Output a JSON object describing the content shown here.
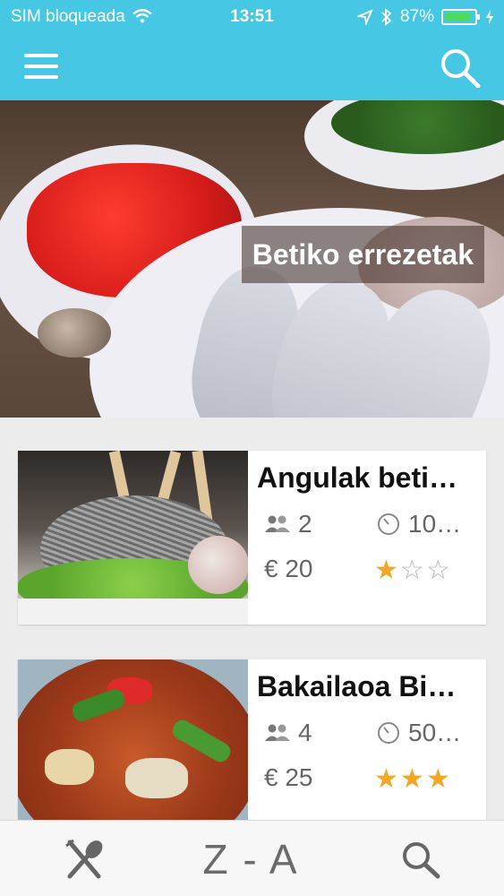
{
  "status_bar": {
    "carrier": "SIM bloqueada",
    "time": "13:51",
    "battery": "87%",
    "battery_level": 0.87
  },
  "header": {
    "menu_icon": "hamburger-icon",
    "search_icon": "search-icon",
    "background_color": "#46c7e3"
  },
  "hero": {
    "title": "Betiko errezetak"
  },
  "recipes": [
    {
      "title": "Angulak beti…",
      "people": "2",
      "time": "10…",
      "price": "€ 20",
      "rating": 1,
      "rating_max": 3
    },
    {
      "title": "Bakailaoa Bi…",
      "people": "4",
      "time": "50…",
      "price": "€ 25",
      "rating": 3,
      "rating_max": 3
    }
  ],
  "tabbar": {
    "sort_label": "Z - A",
    "recipes_icon": "spoon-knife-icon",
    "search_icon": "search-icon"
  },
  "colors": {
    "accent": "#46c7e3",
    "star": "#f5a623"
  }
}
